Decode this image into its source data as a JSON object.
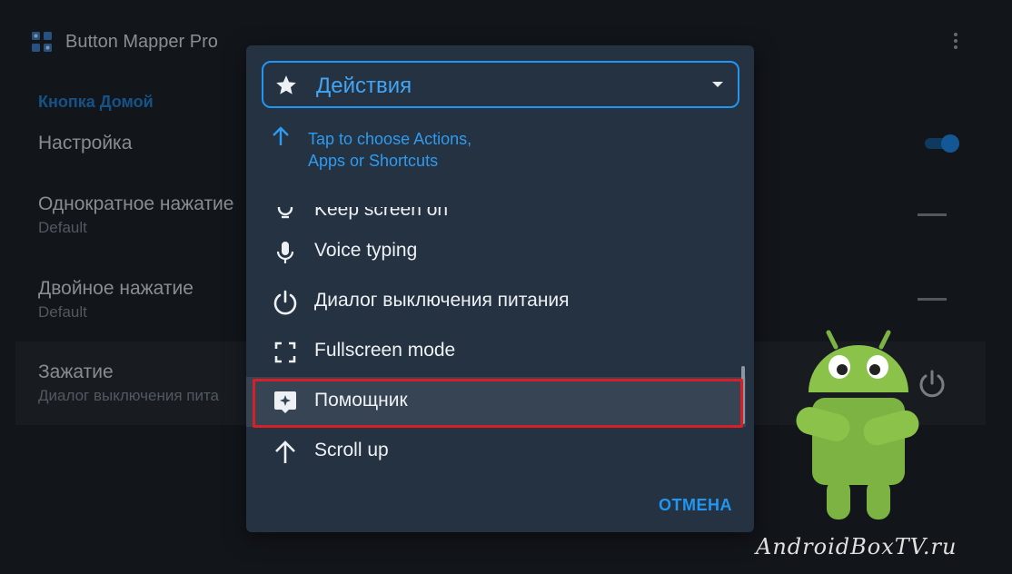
{
  "app": {
    "title": "Button Mapper Pro",
    "section_header": "Кнопка Домой",
    "prefs": [
      {
        "title": "Настройка",
        "summary": ""
      },
      {
        "title": "Однократное нажатие",
        "summary": "Default"
      },
      {
        "title": "Двойное нажатие",
        "summary": "Default"
      },
      {
        "title": "Зажатие",
        "summary": "Диалог выключения пита"
      }
    ],
    "toggle_on": true,
    "accent_color": "#1e88e5"
  },
  "dialog": {
    "dropdown_label": "Действия",
    "hint": "Tap to choose Actions, Apps or Shortcuts",
    "items": [
      {
        "label": "Keep screen on",
        "icon": "lightbulb-icon"
      },
      {
        "label": "Voice typing",
        "icon": "microphone-icon"
      },
      {
        "label": "Диалог выключения питания",
        "icon": "power-icon"
      },
      {
        "label": "Fullscreen mode",
        "icon": "fullscreen-icon"
      },
      {
        "label": "Помощник",
        "icon": "assistant-icon",
        "selected": true
      },
      {
        "label": "Scroll up",
        "icon": "arrow-up-icon"
      }
    ],
    "cancel_label": "ОТМЕНА",
    "highlight_color": "#d81e27"
  },
  "watermark": "AndroidBoxTV.ru"
}
